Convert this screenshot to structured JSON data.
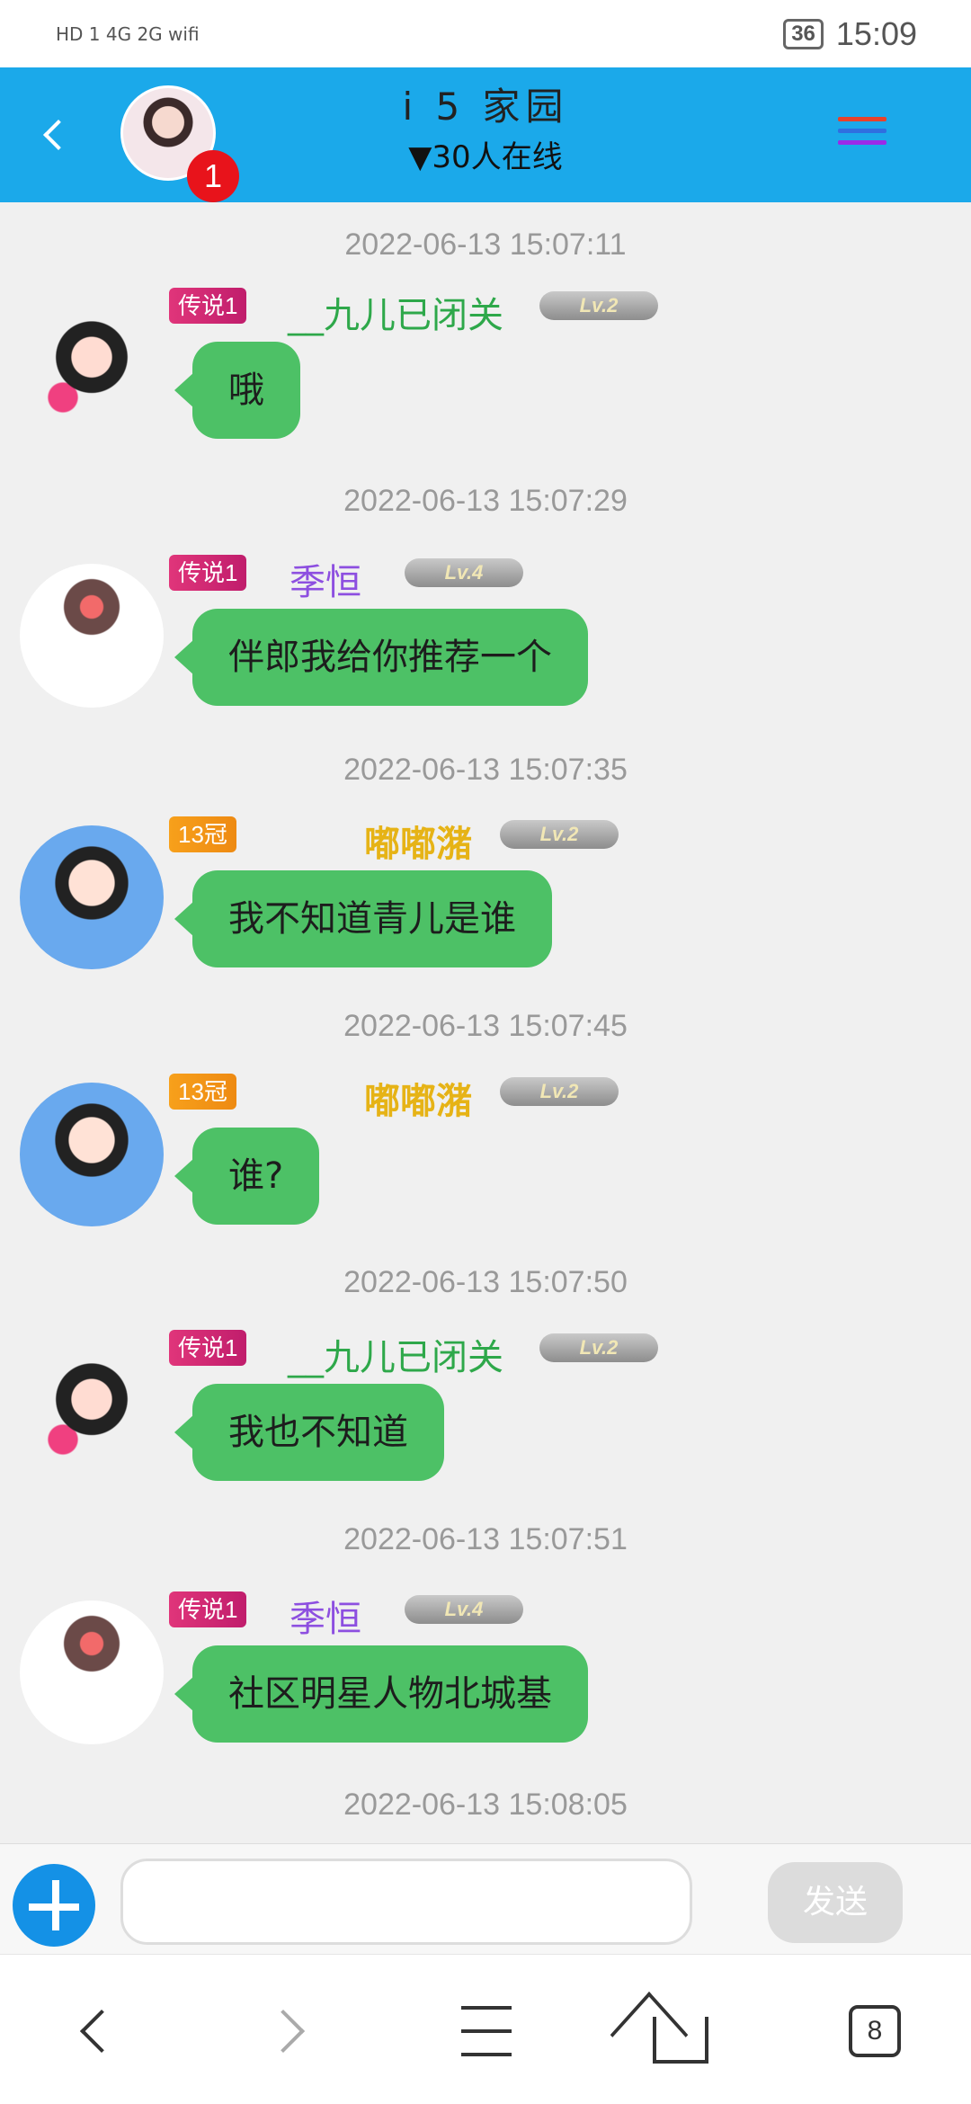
{
  "statusbar": {
    "left_icons": "HD 1 4G 2G wifi",
    "battery": "36",
    "time": "15:09"
  },
  "header": {
    "title": "i 5 家园",
    "online": "▼30人在线",
    "badge": "1"
  },
  "messages": [
    {
      "time": "2022-06-13 15:07:11",
      "tag": "传说1",
      "nick": "__九儿已闭关",
      "level": "Lv.2",
      "text": "哦",
      "avatar": "girl"
    },
    {
      "time": "2022-06-13 15:07:29",
      "tag": "传说1",
      "nick": "季恒",
      "level": "Lv.4",
      "text": "伴郎我给你推荐一个",
      "avatar": "cat"
    },
    {
      "time": "2022-06-13 15:07:35",
      "tag": "13冠",
      "nick": "嘟嘟潴",
      "level": "Lv.2",
      "text": "我不知道青儿是谁",
      "avatar": "blue"
    },
    {
      "time": "2022-06-13 15:07:45",
      "tag": "13冠",
      "nick": "嘟嘟潴",
      "level": "Lv.2",
      "text": "谁?",
      "avatar": "blue"
    },
    {
      "time": "2022-06-13 15:07:50",
      "tag": "传说1",
      "nick": "__九儿已闭关",
      "level": "Lv.2",
      "text": "我也不知道",
      "avatar": "girl"
    },
    {
      "time": "2022-06-13 15:07:51",
      "tag": "传说1",
      "nick": "季恒",
      "level": "Lv.4",
      "text": "社区明星人物北城基",
      "avatar": "cat"
    }
  ],
  "last_time": "2022-06-13 15:08:05",
  "input": {
    "send_label": "发送"
  },
  "navbar": {
    "tabs_count": "8"
  },
  "colors": {
    "header": "#1ba9ea",
    "bubble": "#4dc166"
  }
}
